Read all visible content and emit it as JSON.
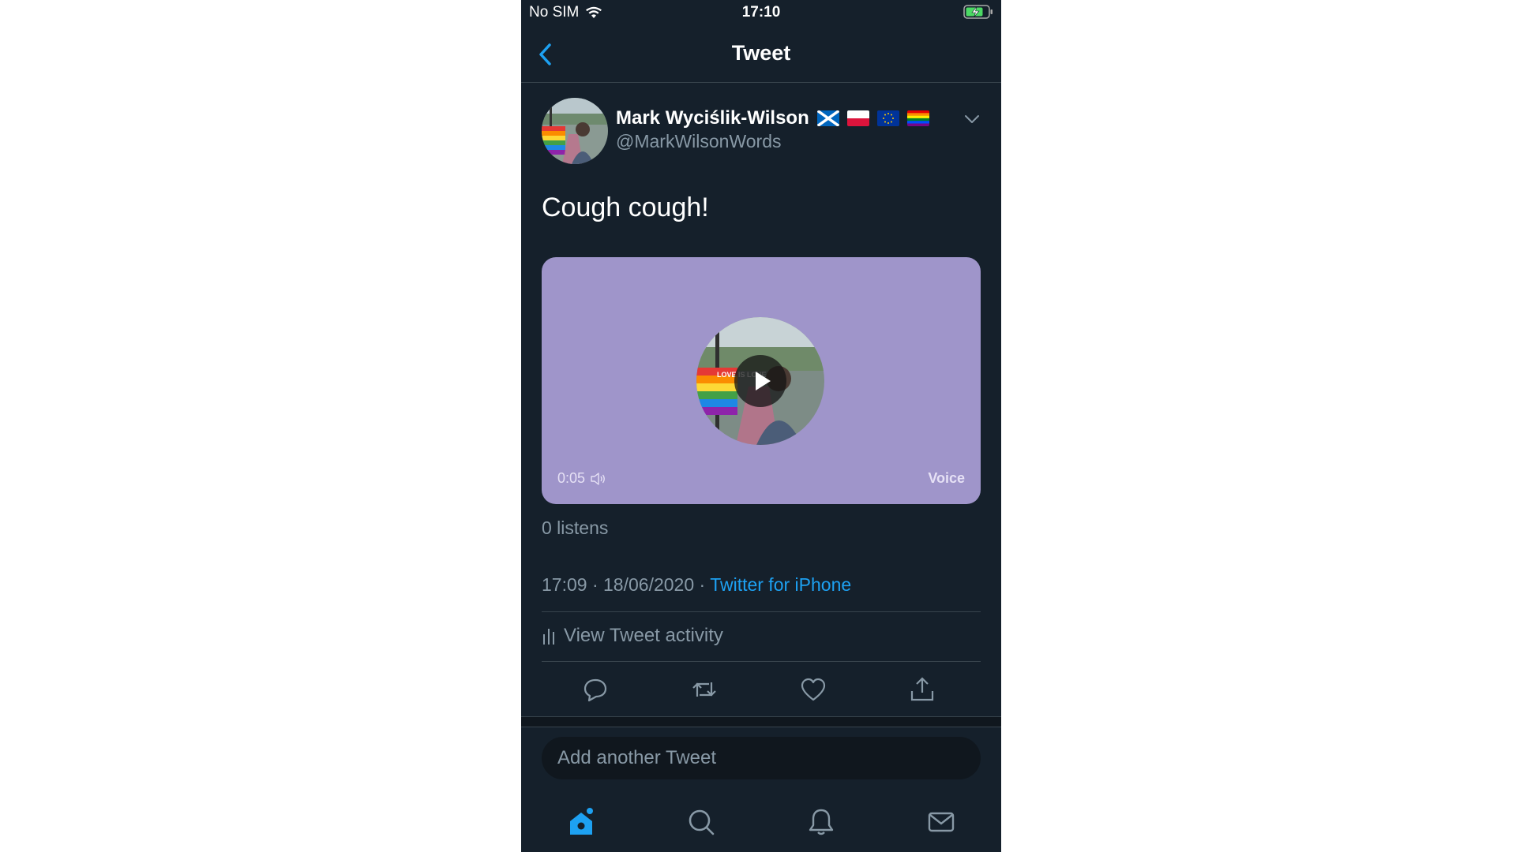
{
  "status_bar": {
    "carrier": "No SIM",
    "time": "17:10",
    "icons": [
      "wifi-icon",
      "battery-charging-icon"
    ]
  },
  "nav": {
    "title": "Tweet",
    "back_icon": "chevron-left-icon"
  },
  "tweet": {
    "author_name": "Mark Wyciślik-Wilson",
    "author_flags": [
      "scotland-flag",
      "poland-flag",
      "eu-flag",
      "rainbow-flag"
    ],
    "author_handle": "@MarkWilsonWords",
    "text": "Cough cough!",
    "media": {
      "duration": "0:05",
      "label": "Voice",
      "thumb_text": "LOVE IS LOVE"
    },
    "listens": "0 listens",
    "time": "17:09",
    "date": "18/06/2020",
    "separator": "·",
    "source": "Twitter for iPhone",
    "activity_label": "View Tweet activity"
  },
  "actions": [
    "reply-icon",
    "retweet-icon",
    "like-icon",
    "share-icon"
  ],
  "compose": {
    "placeholder": "Add another Tweet"
  },
  "tabs": [
    "home-icon",
    "search-icon",
    "notifications-icon",
    "messages-icon"
  ],
  "colors": {
    "background": "#15202b",
    "accent": "#1da1f2",
    "secondary_text": "#8899a6",
    "media_bg": "#9f95ca"
  }
}
